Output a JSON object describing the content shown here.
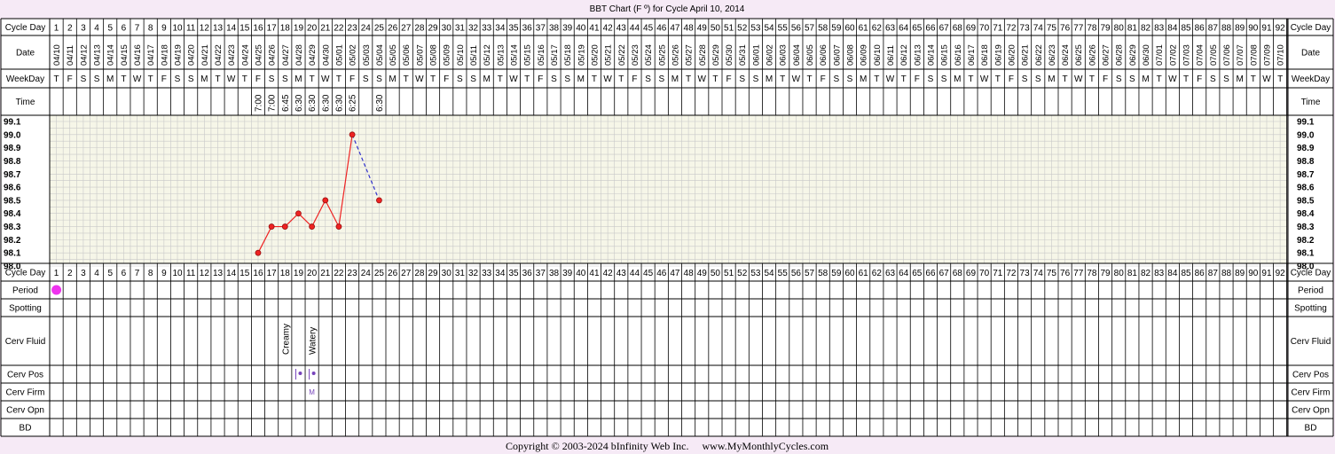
{
  "title": "BBT Chart (F º) for Cycle April 10, 2014",
  "footer": "Copyright © 2003-2024 bInfinity Web Inc.     www.MyMonthlyCycles.com",
  "row_labels": {
    "cycle_day": "Cycle Day",
    "date": "Date",
    "weekday": "WeekDay",
    "time": "Time",
    "period": "Period",
    "spotting": "Spotting",
    "cerv_fluid": "Cerv Fluid",
    "cerv_pos": "Cerv Pos",
    "cerv_firm": "Cerv Firm",
    "cerv_opn": "Cerv Opn",
    "bd": "BD"
  },
  "cycle_days": [
    1,
    2,
    3,
    4,
    5,
    6,
    7,
    8,
    9,
    10,
    11,
    12,
    13,
    14,
    15,
    16,
    17,
    18,
    19,
    20,
    21,
    22,
    23,
    24,
    25,
    26,
    27,
    28,
    29,
    30,
    31,
    32,
    33,
    34,
    35,
    36,
    37,
    38,
    39,
    40,
    41,
    42,
    43,
    44,
    45,
    46,
    47,
    48,
    49,
    50,
    51,
    52,
    53,
    54,
    55,
    56,
    57,
    58,
    59,
    60,
    61,
    62,
    63,
    64,
    65,
    66,
    67,
    68,
    69,
    70,
    71,
    72,
    73,
    74,
    75,
    76,
    77,
    78,
    79,
    80,
    81,
    82,
    83,
    84,
    85,
    86,
    87,
    88,
    89,
    90,
    91,
    92
  ],
  "dates": [
    "04/10",
    "04/11",
    "04/12",
    "04/13",
    "04/14",
    "04/15",
    "04/16",
    "04/17",
    "04/18",
    "04/19",
    "04/20",
    "04/21",
    "04/22",
    "04/23",
    "04/24",
    "04/25",
    "04/26",
    "04/27",
    "04/28",
    "04/29",
    "04/30",
    "05/01",
    "05/02",
    "05/03",
    "05/04",
    "05/05",
    "05/06",
    "05/07",
    "05/08",
    "05/09",
    "05/10",
    "05/11",
    "05/12",
    "05/13",
    "05/14",
    "05/15",
    "05/16",
    "05/17",
    "05/18",
    "05/19",
    "05/20",
    "05/21",
    "05/22",
    "05/23",
    "05/24",
    "05/25",
    "05/26",
    "05/27",
    "05/28",
    "05/29",
    "05/30",
    "05/31",
    "06/01",
    "06/02",
    "06/03",
    "06/04",
    "06/05",
    "06/06",
    "06/07",
    "06/08",
    "06/09",
    "06/10",
    "06/11",
    "06/12",
    "06/13",
    "06/14",
    "06/15",
    "06/16",
    "06/17",
    "06/18",
    "06/19",
    "06/20",
    "06/21",
    "06/22",
    "06/23",
    "06/24",
    "06/25",
    "06/26",
    "06/27",
    "06/28",
    "06/29",
    "06/30",
    "07/01",
    "07/02",
    "07/03",
    "07/04",
    "07/05",
    "07/06",
    "07/07",
    "07/08",
    "07/09",
    "07/10"
  ],
  "weekdays": [
    "T",
    "F",
    "S",
    "S",
    "M",
    "T",
    "W",
    "T",
    "F",
    "S",
    "S",
    "M",
    "T",
    "W",
    "T",
    "F",
    "S",
    "S",
    "M",
    "T",
    "W",
    "T",
    "F",
    "S",
    "S",
    "M",
    "T",
    "W",
    "T",
    "F",
    "S",
    "S",
    "M",
    "T",
    "W",
    "T",
    "F",
    "S",
    "S",
    "M",
    "T",
    "W",
    "T",
    "F",
    "S",
    "S",
    "M",
    "T",
    "W",
    "T",
    "F",
    "S",
    "S",
    "M",
    "T",
    "W",
    "T",
    "F",
    "S",
    "S",
    "M",
    "T",
    "W",
    "T",
    "F",
    "S",
    "S",
    "M",
    "T",
    "W",
    "T",
    "F",
    "S",
    "S",
    "M",
    "T",
    "W",
    "T",
    "F",
    "S",
    "S",
    "M",
    "T",
    "W",
    "T",
    "F",
    "S",
    "S",
    "M",
    "T",
    "W",
    "T"
  ],
  "times": [
    {
      "day": 16,
      "time": "7:00"
    },
    {
      "day": 17,
      "time": "7:00"
    },
    {
      "day": 18,
      "time": "6:45"
    },
    {
      "day": 19,
      "time": "6:30"
    },
    {
      "day": 20,
      "time": "6:30"
    },
    {
      "day": 21,
      "time": "6:30"
    },
    {
      "day": 22,
      "time": "6:30"
    },
    {
      "day": 23,
      "time": "6:25"
    },
    {
      "day": 25,
      "time": "6:30"
    }
  ],
  "period_days": [
    1
  ],
  "cerv_fluid": [
    {
      "day": 18,
      "label": "Creamy"
    },
    {
      "day": 20,
      "label": "Watery"
    }
  ],
  "cerv_pos": [
    19,
    20
  ],
  "cerv_firm": [
    {
      "day": 20,
      "label": "M"
    }
  ],
  "colors": {
    "temp_line": "#ee2222",
    "temp_point": "#ee2222",
    "dashed_line": "#3333cc",
    "period": "#ee33ee",
    "symbol": "#7744bb",
    "grid_bg": "#f6f6e8",
    "grid_line": "#c8c8c8",
    "page_bg": "#f6eaf6"
  },
  "chart_data": {
    "type": "line",
    "title": "BBT Chart (F º) for Cycle April 10, 2014",
    "xlabel": "Cycle Day",
    "ylabel": "",
    "ylim": [
      98.0,
      99.1
    ],
    "y_ticks": [
      "99.1",
      "99.0",
      "98.9",
      "98.8",
      "98.7",
      "98.6",
      "98.5",
      "98.4",
      "98.3",
      "98.2",
      "98.1",
      "98.0"
    ],
    "grid": true,
    "series": [
      {
        "x": [
          16,
          17,
          18,
          19,
          20,
          21,
          22,
          23
        ],
        "y": [
          98.1,
          98.3,
          98.3,
          98.4,
          98.3,
          98.5,
          98.3,
          99.0
        ]
      }
    ],
    "dashed_segment": {
      "x": [
        23,
        25
      ],
      "y": [
        99.0,
        98.5
      ]
    }
  }
}
